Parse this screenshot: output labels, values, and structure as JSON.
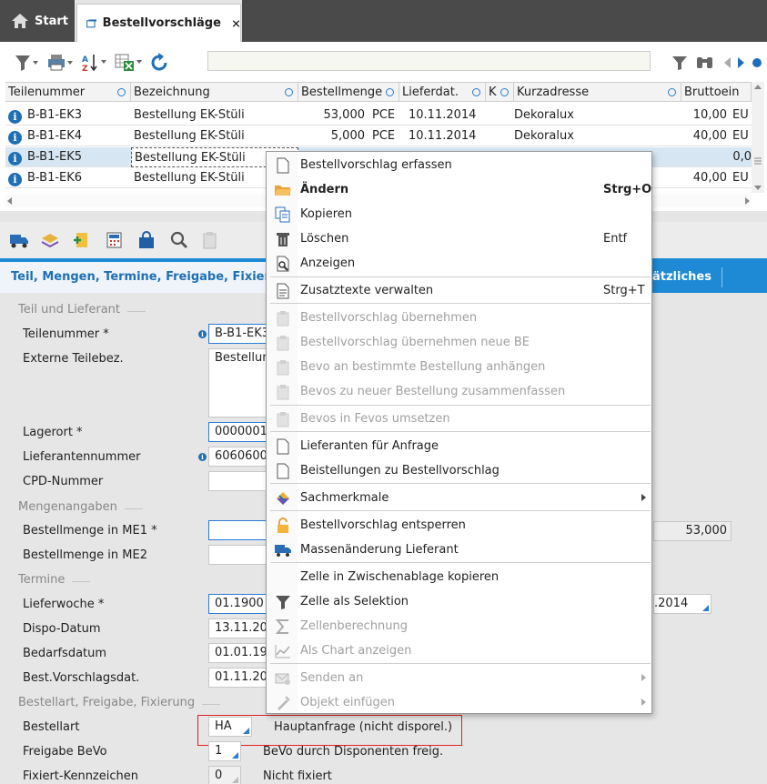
{
  "tabs": {
    "start_label": "Start",
    "active_label": "Bestellvorschläge"
  },
  "grid": {
    "columns": [
      "Teilenummer",
      "Bezeichnung",
      "Bestellmenge",
      "Lieferdat.",
      "K",
      "Kurzadresse",
      "Bruttoein"
    ],
    "rows": [
      {
        "teil": "B-B1-EK3",
        "bez": "Bestellung EK-Stüli",
        "menge": "53,000",
        "einheit": "PCE",
        "datum": "10.11.2014",
        "adresse": "Dekoralux",
        "brutto": "10,00",
        "waehr": "EU"
      },
      {
        "teil": "B-B1-EK4",
        "bez": "Bestellung EK-Stüli",
        "menge": "5,000",
        "einheit": "PCE",
        "datum": "10.11.2014",
        "adresse": "Dekoralux",
        "brutto": "40,00",
        "waehr": "EU"
      },
      {
        "teil": "B-B1-EK5",
        "bez": "Bestellung EK-Stüli",
        "menge": "",
        "einheit": "",
        "datum": "",
        "adresse": "",
        "brutto": "0,0",
        "waehr": ""
      },
      {
        "teil": "B-B1-EK6",
        "bez": "Bestellung EK-Stüli",
        "menge": "",
        "einheit": "",
        "datum": "",
        "adresse": "",
        "brutto": "40,00",
        "waehr": "EU"
      }
    ]
  },
  "section": {
    "active_tab": "Teil, Mengen, Termine, Freigabe, Fixierung",
    "right_tab": "ätzliches"
  },
  "form": {
    "group_teil": "Teil und Lieferant",
    "teilenummer_label": "Teilenummer *",
    "teilenummer_value": "B-B1-EK3",
    "externe_label": "Externe Teilebez.",
    "externe_value": "Bestellun",
    "lagerort_label": "Lagerort *",
    "lagerort_value": "0000001",
    "lieferantennummer_label": "Lieferantennummer",
    "lieferantennummer_value": "6060600",
    "cpd_label": "CPD-Nummer",
    "group_menge": "Mengenangaben",
    "me1_label": "Bestellmenge in ME1 *",
    "me1_right_value": "53,000",
    "me2_label": "Bestellmenge in ME2",
    "group_termine": "Termine",
    "lieferwoche_label": "Lieferwoche *",
    "lieferwoche_value": "01.1900",
    "lieferwoche_right_value": ".2014",
    "dispo_label": "Dispo-Datum",
    "dispo_value": "13.11.20",
    "bedarf_label": "Bedarfsdatum",
    "bedarf_value": "01.01.19",
    "bestvor_label": "Best.Vorschlagsdat.",
    "bestvor_value": "01.11.20",
    "group_bestellart": "Bestellart, Freigabe, Fixierung",
    "bestellart_label": "Bestellart",
    "bestellart_value": "HA",
    "bestellart_desc": "Hauptanfrage (nicht disporel.)",
    "freigabe_label": "Freigabe BeVo",
    "freigabe_value": "1",
    "freigabe_desc": "BeVo durch Disponenten freig.",
    "fixiert_label": "Fixiert-Kennzeichen",
    "fixiert_value": "0",
    "fixiert_desc": "Nicht fixiert"
  },
  "context_menu": {
    "items": [
      {
        "label": "Bestellvorschlag erfassen",
        "shortcut": "",
        "icon": "document-icon"
      },
      {
        "label": "Ändern",
        "shortcut": "Strg+O",
        "icon": "folder-icon"
      },
      {
        "label": "Kopieren",
        "shortcut": "",
        "icon": "copy-icon"
      },
      {
        "label": "Löschen",
        "shortcut": "Entf",
        "icon": "trash-icon"
      },
      {
        "label": "Anzeigen",
        "shortcut": "",
        "icon": "view-icon"
      },
      {
        "label": "Zusatztexte verwalten",
        "shortcut": "Strg+T",
        "icon": "text-document-icon"
      },
      {
        "label": "Bestellvorschlag übernehmen",
        "shortcut": "",
        "icon": "clipboard-icon"
      },
      {
        "label": "Bestellvorschlag übernehmen neue BE",
        "shortcut": "",
        "icon": "clipboard-icon"
      },
      {
        "label": "Bevo an bestimmte Bestellung anhängen",
        "shortcut": "",
        "icon": "clipboard-icon"
      },
      {
        "label": "Bevos zu neuer Bestellung zusammenfassen",
        "shortcut": "",
        "icon": "clipboard-icon"
      },
      {
        "label": "Bevos in Fevos umsetzen",
        "shortcut": "",
        "icon": "clipboard-icon"
      },
      {
        "label": "Lieferanten für Anfrage",
        "shortcut": "",
        "icon": "document-icon"
      },
      {
        "label": "Beistellungen zu Bestellvorschlag",
        "shortcut": "",
        "icon": "document-icon"
      },
      {
        "label": "Sachmerkmale",
        "shortcut": "",
        "icon": "tag-icon"
      },
      {
        "label": "Bestellvorschlag entsperren",
        "shortcut": "",
        "icon": "unlock-icon"
      },
      {
        "label": "Massenänderung Lieferant",
        "shortcut": "",
        "icon": "truck-icon"
      },
      {
        "label": "Zelle in Zwischenablage kopieren",
        "shortcut": "",
        "icon": ""
      },
      {
        "label": "Zelle als Selektion",
        "shortcut": "",
        "icon": "filter-icon"
      },
      {
        "label": "Zellenberechnung",
        "shortcut": "",
        "icon": "sigma-icon"
      },
      {
        "label": "Als Chart anzeigen",
        "shortcut": "",
        "icon": "chart-icon"
      },
      {
        "label": "Senden an",
        "shortcut": "",
        "icon": "send-icon"
      },
      {
        "label": "Objekt einfügen",
        "shortcut": "",
        "icon": "pin-icon"
      }
    ]
  },
  "colors": {
    "accent_blue": "#1e8ad6",
    "highlight_red": "#e02020",
    "dark_tab": "#4a4a4a"
  }
}
